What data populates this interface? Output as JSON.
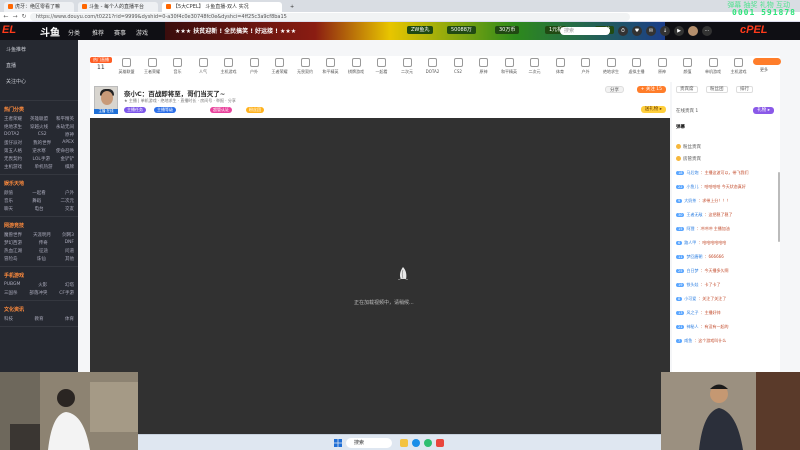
{
  "browser": {
    "tabs": [
      {
        "label": "虎牙：绝区零看了嘛",
        "active": false
      },
      {
        "label": "斗鱼 - 每个人的直播平台",
        "active": false
      },
      {
        "label": "【5大CPEL】 斗鱼直播-双人 实况",
        "active": true
      }
    ],
    "url": "https://www.douyu.com/t0221?rid=9999&dyshid=0-a30f4c0e30748fc0e&dyshci=4ff25c3a9cf8ba15",
    "overlay_main": "0001 591878",
    "overlay_top": "弹幕 抽奖 礼物 互动"
  },
  "site": {
    "logo_left": "EL",
    "logo_brand": "斗鱼",
    "nav": [
      "分类",
      "推荐",
      "赛事",
      "游戏",
      "娱乐",
      "PEL大赛"
    ],
    "banner_text": "★★★ 扶贫迎新 ! 全民搞笑 ! 好运接 ! ★★★",
    "banner_chips": [
      "ZW鱼丸",
      "50088万",
      "30万币",
      "1元机",
      "1k钻"
    ],
    "search_placeholder": "搜索",
    "logo_right": "cPEL"
  },
  "sidebar": {
    "top_items": [
      "斗鱼推荐",
      "直播",
      "关注中心"
    ],
    "sections": [
      {
        "title": "热门分类",
        "rows": [
          [
            "王者荣耀",
            "英雄联盟",
            "和平精英"
          ],
          [
            "绝地求生",
            "穿越火线",
            "永劫无间"
          ],
          [
            "DOTA2",
            "CS2",
            "原神"
          ],
          [
            "蛋仔派对",
            "我的世界",
            "APEX"
          ],
          [
            "第五人格",
            "逆水寒",
            "使命召唤"
          ],
          [
            "无畏契约",
            "LOL手游",
            "金铲铲"
          ],
          [
            "主机游戏",
            "单机热游",
            "棋牌"
          ]
        ]
      },
      {
        "title": "娱乐天地",
        "rows": [
          [
            "颜值",
            "一起看",
            "户外"
          ],
          [
            "音乐",
            "舞蹈",
            "二次元"
          ],
          [
            "聊天",
            "电台",
            "交友"
          ]
        ]
      },
      {
        "title": "网游竞技",
        "rows": [
          [
            "魔兽世界",
            "天涯明月",
            "剑网3"
          ],
          [
            "梦幻西游",
            "传奇",
            "DNF"
          ],
          [
            "热血江湖",
            "征途",
            "问道"
          ],
          [
            "冒险岛",
            "诛仙",
            "其他"
          ]
        ]
      },
      {
        "title": "手机游戏",
        "rows": [
          [
            "PUBGM",
            "火影",
            "幻塔"
          ],
          [
            "三国杀",
            "部落冲突",
            "CF手游"
          ]
        ]
      },
      {
        "title": "文化资讯",
        "rows": [
          [
            "科技",
            "教育",
            "体育"
          ]
        ]
      }
    ]
  },
  "categories": {
    "badge": "热门直播",
    "count": "11",
    "items": [
      "推荐分类",
      "英雄联盟",
      "王者荣耀",
      "音乐",
      "人气",
      "主机游戏",
      "户外",
      "王者荣耀",
      "无畏契约",
      "和平精英",
      "棋牌游戏",
      "一起看",
      "二次元",
      "DOTA2",
      "CS2",
      "原神",
      "和平精英",
      "二次元",
      "体育",
      "户外",
      "绝地求生",
      "虚拟主播",
      "原神",
      "颜值",
      "单机游戏",
      "主机游戏",
      "更多"
    ]
  },
  "room": {
    "avatar_tag": "主播 在线",
    "title": "奈小C：百战即将至，哥们当灭了~",
    "sub": "★ 主播 | 单机游戏 · 绝地求生 · 直播时长 · 房间号 · 举报 · 分享",
    "pills": [
      {
        "label": "主播任务",
        "color": "#7b55e9"
      },
      {
        "label": "主播等级",
        "color": "#2b6ee8"
      },
      {
        "label": "超管认证",
        "color": "#e8419b"
      },
      {
        "label": "粉丝团",
        "color": "#ffb21d"
      }
    ],
    "follow_label": "+ 关注 15",
    "share_label": "分享",
    "gift_label": "送礼物 ▸"
  },
  "video": {
    "loading_text": "正在加载视频中，请稍候..."
  },
  "rpanel": {
    "tabs": [
      "贵宾席",
      "粉丝团",
      "排行"
    ],
    "header": "弹幕",
    "rank_label": "在线贵宾 1",
    "gift_btn": "礼物 ▸",
    "vip_rows": [
      "粉丝贵宾",
      "房管贵宾"
    ],
    "chat": [
      {
        "lvl": "18",
        "user": "马后炮",
        "text": "：主播这波可以，带飞我们"
      },
      {
        "lvl": "22",
        "user": "小鱼儿",
        "text": "：哈哈哈哈 今天状态真好"
      },
      {
        "lvl": "9",
        "user": "大奶茶",
        "text": "：求带上分！！！"
      },
      {
        "lvl": "30",
        "user": "王者无敌",
        "text": "：这把稳了稳了"
      },
      {
        "lvl": "15",
        "user": "阿狸",
        "text": "：冲冲冲 主播加油"
      },
      {
        "lvl": "6",
        "user": "路人甲",
        "text": "：哈哈哈哈哈哈"
      },
      {
        "lvl": "11",
        "user": "梦回唐朝",
        "text": "：666666"
      },
      {
        "lvl": "25",
        "user": "白日梦",
        "text": "：今天播多久啊"
      },
      {
        "lvl": "19",
        "user": "铁头娃",
        "text": "：卡了卡了"
      },
      {
        "lvl": "8",
        "user": "小可爱",
        "text": "：关注了关注了"
      },
      {
        "lvl": "13",
        "user": "风之子",
        "text": "：主播好帅"
      },
      {
        "lvl": "21",
        "user": "神秘人",
        "text": "：有没有一起的"
      },
      {
        "lvl": "7",
        "user": "咸鱼",
        "text": "：这个游戏叫什么"
      }
    ]
  },
  "taskbar": {
    "search": "搜索"
  },
  "colors": {
    "accent": "#ff7d2a",
    "overlay_green": "#2fe37a",
    "sidebar_bg": "#262931",
    "video_bg": "#313131"
  }
}
